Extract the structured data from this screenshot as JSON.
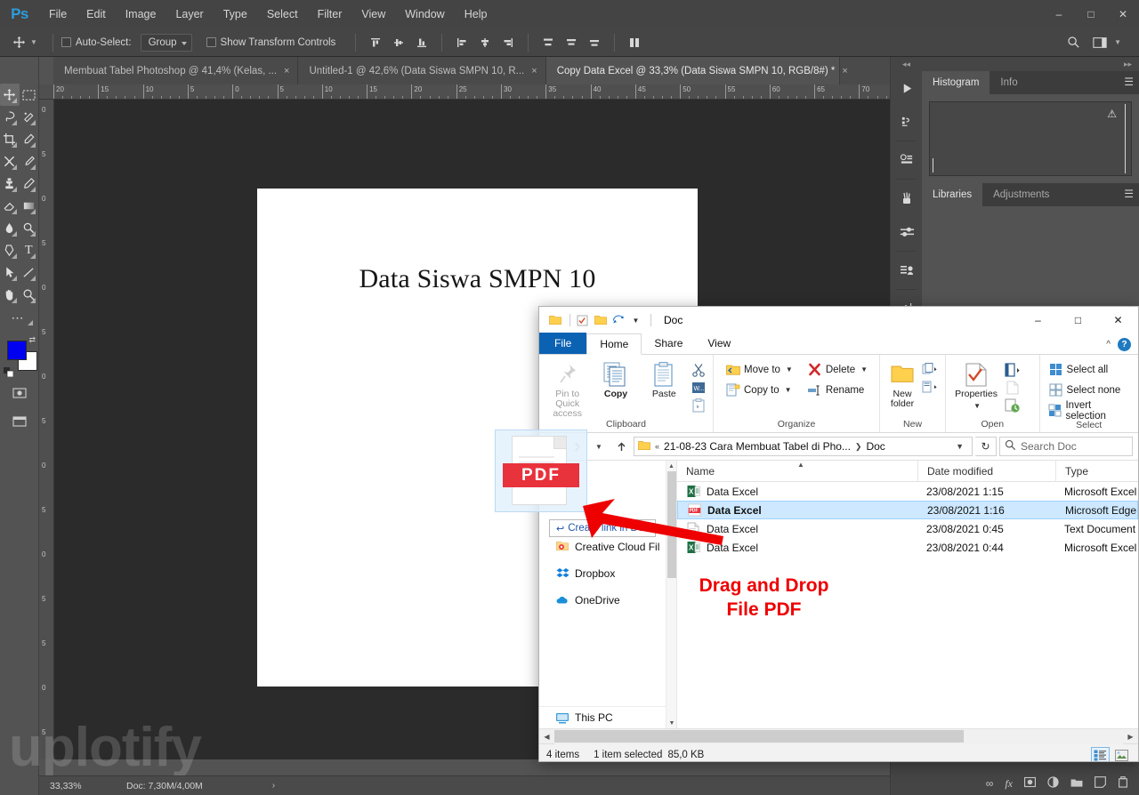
{
  "photoshop": {
    "logo": "Ps",
    "menus": [
      "File",
      "Edit",
      "Image",
      "Layer",
      "Type",
      "Select",
      "Filter",
      "View",
      "Window",
      "Help"
    ],
    "window_buttons": [
      "minimize",
      "maximize",
      "close"
    ],
    "options_bar": {
      "move_tool_icon": "move-tool-icon",
      "auto_select_label": "Auto-Select:",
      "auto_select_value": "Group",
      "show_transform_label": "Show Transform Controls",
      "search_icon": "search-icon",
      "workspace_icon": "workspace-icon"
    },
    "tabs": [
      {
        "label": "Membuat Tabel Photoshop @ 41,4% (Kelas, ...",
        "active": false,
        "close": "×"
      },
      {
        "label": "Untitled-1 @ 42,6% (Data Siswa SMPN 10, R...",
        "active": false,
        "close": "×"
      },
      {
        "label": "Copy Data Excel @ 33,3% (Data Siswa SMPN 10, RGB/8#) *",
        "active": true,
        "close": "×"
      }
    ],
    "tools": [
      "move-tool-icon",
      "marquee-tool-icon",
      "lasso-tool-icon",
      "quick-select-tool-icon",
      "crop-tool-icon",
      "eyedropper-tool-icon",
      "healing-brush-tool-icon",
      "brush-tool-icon",
      "clone-stamp-tool-icon",
      "history-brush-tool-icon",
      "eraser-tool-icon",
      "gradient-tool-icon",
      "blur-tool-icon",
      "dodge-tool-icon",
      "pen-tool-icon",
      "type-tool-icon",
      "path-select-tool-icon",
      "shape-tool-icon",
      "hand-tool-icon",
      "zoom-tool-icon",
      "edit-toolbar-icon"
    ],
    "colors": {
      "foreground": "#0000f0",
      "background": "#ffffff",
      "ui_bg": "#535353",
      "panel_bg": "#454545",
      "canvas_bg": "#2b2b2b"
    },
    "ruler_h_labels": [
      "20",
      "15",
      "10",
      "5",
      "0",
      "5",
      "10",
      "15",
      "20",
      "25",
      "30",
      "35",
      "40",
      "45",
      "50",
      "55",
      "60",
      "65",
      "70"
    ],
    "ruler_v_labels": [
      "0",
      "5",
      "0",
      "5",
      "0",
      "5",
      "0",
      "5",
      "0",
      "5",
      "0",
      "5",
      "5",
      "0",
      "5"
    ],
    "document": {
      "title_text": "Data Siswa SMPN 10"
    },
    "watermark": "uplotify",
    "status_bar": {
      "zoom": "33,33%",
      "doc_info": "Doc: 7,30M/4,00M",
      "expand_arrow": "›"
    },
    "panels": {
      "group1_tabs": [
        {
          "label": "Histogram",
          "active": true
        },
        {
          "label": "Info",
          "active": false
        }
      ],
      "group2_tabs": [
        {
          "label": "Libraries",
          "active": true
        },
        {
          "label": "Adjustments",
          "active": false
        }
      ],
      "histogram_warning_icon": "warning-icon",
      "menu_icon": "panel-menu-icon"
    },
    "dock_rail_icons": [
      "play-icon",
      "actions-icon",
      "3d-icon",
      "brushes-icon",
      "adjustments-icon",
      "clone-source-icon",
      "character-icon",
      "paragraph-icon"
    ],
    "layer_bar_icons": [
      "link-icon",
      "fx-icon",
      "mask-icon",
      "adjustment-icon",
      "group-icon",
      "new-layer-icon",
      "delete-icon"
    ]
  },
  "explorer": {
    "title": "Doc",
    "quick_access_icons": [
      "folder-icon",
      "properties-icon",
      "new-folder-icon",
      "undo-icon",
      "customize-caret-icon"
    ],
    "window_buttons": {
      "minimize": "–",
      "maximize": "□",
      "close": "✕"
    },
    "ribbon_tabs": [
      {
        "label": "File",
        "type": "file"
      },
      {
        "label": "Home",
        "active": true
      },
      {
        "label": "Share",
        "active": false
      },
      {
        "label": "View",
        "active": false
      }
    ],
    "ribbon": {
      "groups": [
        {
          "title": "Clipboard",
          "big_buttons": [
            {
              "label": "Pin to Quick access",
              "icon": "pin-icon",
              "disabled": true
            },
            {
              "label": "Copy",
              "icon": "copy-icon"
            },
            {
              "label": "Paste",
              "icon": "paste-icon"
            }
          ],
          "mini_buttons": [
            "cut-icon",
            "copy-path-icon",
            "paste-shortcut-icon"
          ]
        },
        {
          "title": "Organize",
          "small_buttons": [
            {
              "label": "Move to",
              "icon": "move-to-icon",
              "dropdown": true
            },
            {
              "label": "Copy to",
              "icon": "copy-to-icon",
              "dropdown": true
            },
            {
              "label": "Delete",
              "icon": "delete-icon",
              "dropdown": true
            },
            {
              "label": "Rename",
              "icon": "rename-icon",
              "dropdown": false
            }
          ]
        },
        {
          "title": "New",
          "big_buttons": [
            {
              "label": "New folder",
              "icon": "new-folder-icon"
            }
          ],
          "mini_buttons": [
            "new-item-icon",
            "easy-access-icon"
          ]
        },
        {
          "title": "Open",
          "big_buttons": [
            {
              "label": "Properties",
              "icon": "properties-icon",
              "dropdown": true
            }
          ],
          "mini_buttons": [
            "open-icon",
            "edit-icon",
            "history-icon"
          ]
        },
        {
          "title": "Select",
          "small_buttons": [
            {
              "label": "Select all",
              "icon": "select-all-icon"
            },
            {
              "label": "Select none",
              "icon": "select-none-icon"
            },
            {
              "label": "Invert selection",
              "icon": "invert-selection-icon"
            }
          ]
        }
      ],
      "collapse_caret": "^",
      "help_icon": "help-icon"
    },
    "address_bar": {
      "back_icon": "back-icon",
      "forward_icon": "forward-icon",
      "recent_icon": "recent-locations-icon",
      "up_icon": "up-icon",
      "folder_icon": "folder-icon",
      "overflow": "«",
      "crumbs": [
        "21-08-23 Cara Membuat Tabel di Pho...",
        "Doc"
      ],
      "dropdown_icon": "chevron-down-icon",
      "refresh_icon": "refresh-icon"
    },
    "search": {
      "placeholder": "Search Doc",
      "icon": "search-icon"
    },
    "nav_pane": {
      "hidden_items": [
        "Doc",
        "..."
      ],
      "items": [
        {
          "label": "Creative Cloud Fil",
          "icon": "creative-cloud-icon"
        },
        {
          "label": "Dropbox",
          "icon": "dropbox-icon"
        },
        {
          "label": "OneDrive",
          "icon": "onedrive-icon"
        }
      ],
      "bottom_item": {
        "label": "This PC",
        "icon": "this-pc-icon"
      }
    },
    "file_list": {
      "columns": [
        "Name",
        "Date modified",
        "Type"
      ],
      "sort_column": "Name",
      "sort_direction": "asc",
      "rows": [
        {
          "name": "Data Excel",
          "date": "23/08/2021 1:15",
          "type": "Microsoft Excel C",
          "icon": "excel-icon",
          "selected": false
        },
        {
          "name": "Data Excel",
          "date": "23/08/2021 1:16",
          "type": "Microsoft Edge P",
          "icon": "pdf-icon",
          "selected": true
        },
        {
          "name": "Data Excel",
          "date": "23/08/2021 0:45",
          "type": "Text Document",
          "icon": "text-icon",
          "selected": false
        },
        {
          "name": "Data Excel",
          "date": "23/08/2021 0:44",
          "type": "Microsoft Excel W",
          "icon": "excel-icon",
          "selected": false
        }
      ]
    },
    "status_bar": {
      "item_count": "4 items",
      "selection": "1 item selected",
      "size": "85,0 KB",
      "view_buttons": [
        "details-view-icon",
        "large-icons-view-icon"
      ]
    }
  },
  "drag": {
    "ghost_label": "PDF",
    "tooltip_text": "Create link in Doc",
    "tooltip_icon": "link-shortcut-icon",
    "annotation_line1": "Drag and Drop",
    "annotation_line2": "File PDF",
    "annotation_color": "#ee0000"
  }
}
